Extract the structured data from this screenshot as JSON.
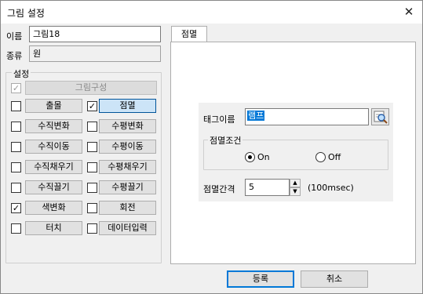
{
  "window": {
    "title": "그림 설정",
    "close_glyph": "✕"
  },
  "form": {
    "name_label": "이름",
    "name_value": "그림18",
    "type_label": "종류",
    "type_value": "원"
  },
  "settings": {
    "group_title": "설정",
    "picture_config_label": "그림구성",
    "picture_config_checked": true,
    "items": [
      {
        "label": "출몰",
        "checked": false
      },
      {
        "label": "점멸",
        "checked": true
      },
      {
        "label": "수직변화",
        "checked": false
      },
      {
        "label": "수평변화",
        "checked": false
      },
      {
        "label": "수직이동",
        "checked": false
      },
      {
        "label": "수평이동",
        "checked": false
      },
      {
        "label": "수직채우기",
        "checked": false
      },
      {
        "label": "수평채우기",
        "checked": false
      },
      {
        "label": "수직끌기",
        "checked": false
      },
      {
        "label": "수평끌기",
        "checked": false
      },
      {
        "label": "색변화",
        "checked": true
      },
      {
        "label": "회전",
        "checked": false
      },
      {
        "label": "터치",
        "checked": false
      },
      {
        "label": "데이터입력",
        "checked": false
      }
    ]
  },
  "tab": {
    "label": "점멸"
  },
  "blink": {
    "tag_label": "태그이름",
    "tag_value": "램프",
    "condition_title": "점멸조건",
    "option_on": "On",
    "option_off": "Off",
    "selected": "On",
    "interval_label": "점멸간격",
    "interval_value": "5",
    "interval_unit": "(100msec)"
  },
  "footer": {
    "ok_label": "등록",
    "cancel_label": "취소"
  },
  "check_glyph": "✓"
}
